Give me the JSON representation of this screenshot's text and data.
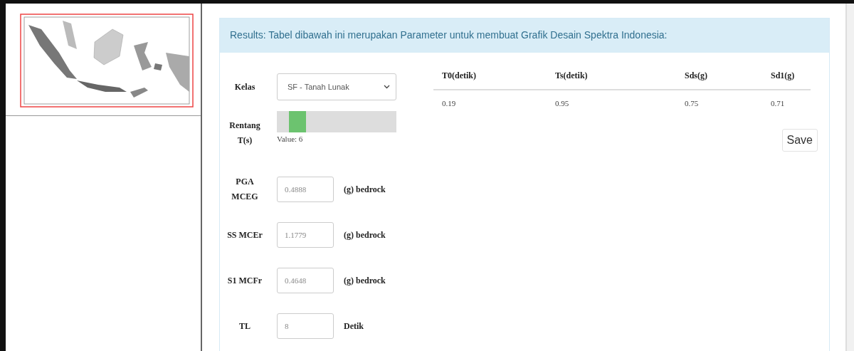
{
  "results": {
    "title": "Results: Tabel dibawah ini merupakan Parameter untuk membuat Grafik Desain Spektra Indonesia:"
  },
  "form": {
    "kelas": {
      "label": "Kelas",
      "value": "SF - Tanah Lunak"
    },
    "rentang": {
      "label": "Rentang T(s)",
      "level": 0.1,
      "reading": "Value: 6"
    },
    "fields": [
      {
        "label": "PGA MCEG",
        "value": "0.4888",
        "unit": "(g) bedrock"
      },
      {
        "label": "SS MCEr",
        "value": "1.1779",
        "unit": "(g) bedrock"
      },
      {
        "label": "S1 MCFr",
        "value": "0.4648",
        "unit": "(g) bedrock"
      },
      {
        "label": "TL",
        "value": "8",
        "unit": "Detik"
      }
    ]
  },
  "table": {
    "columns": [
      "T0(detik)",
      "Ts(detik)",
      "Sds(g)",
      "Sd1(g)"
    ],
    "rows": [
      [
        "0.19",
        "0.95",
        "0.75",
        "0.71"
      ]
    ]
  },
  "save_button": "Save"
}
